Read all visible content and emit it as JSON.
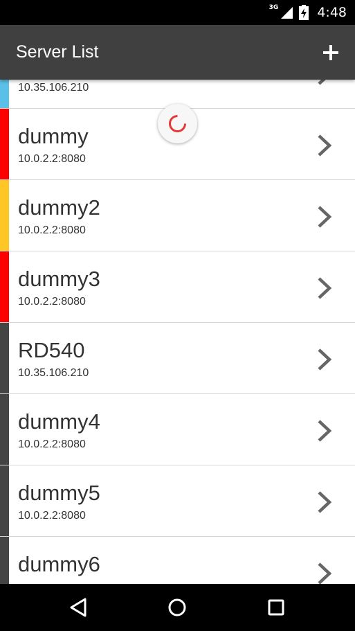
{
  "status_bar": {
    "network_type": "3G",
    "time": "4:48",
    "icons": [
      "signal-icon",
      "battery-charging-icon"
    ]
  },
  "app_bar": {
    "title": "Server List",
    "action_icon": "add-icon"
  },
  "servers": [
    {
      "name": "",
      "address": "10.35.106.210",
      "status_color": "#5bc0e8"
    },
    {
      "name": "dummy",
      "address": "10.0.2.2:8080",
      "status_color": "#ff0000"
    },
    {
      "name": "dummy2",
      "address": "10.0.2.2:8080",
      "status_color": "#ffc726"
    },
    {
      "name": "dummy3",
      "address": "10.0.2.2:8080",
      "status_color": "#ff0000"
    },
    {
      "name": "RD540",
      "address": "10.35.106.210",
      "status_color": "#444444"
    },
    {
      "name": "dummy4",
      "address": "10.0.2.2:8080",
      "status_color": "#444444"
    },
    {
      "name": "dummy5",
      "address": "10.0.2.2:8080",
      "status_color": "#444444"
    },
    {
      "name": "dummy6",
      "address": "",
      "status_color": "#444444"
    }
  ],
  "loading_indicator": {
    "color": "#e53935"
  },
  "nav_bar": {
    "buttons": [
      "back-icon",
      "home-icon",
      "recents-icon"
    ]
  }
}
